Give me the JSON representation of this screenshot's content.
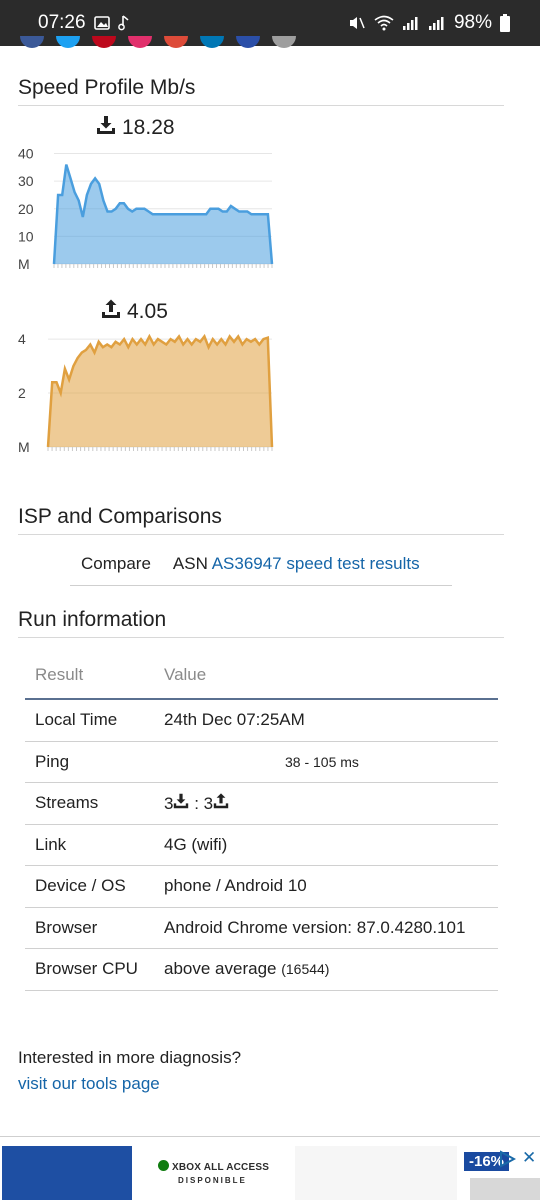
{
  "status_bar": {
    "time": "07:26",
    "battery": "98%"
  },
  "social_colors": [
    "#3b5998",
    "#1da1f2",
    "#bd081c",
    "#e1306c",
    "#dd4b39",
    "#0077b5",
    "#2b4fa8",
    "#9e9e9e"
  ],
  "speed_profile": {
    "heading": "Speed Profile Mb/s",
    "download": {
      "value": "18.28",
      "y_ticks": [
        "40",
        "30",
        "20",
        "10",
        "M"
      ],
      "color": "#4a9ede"
    },
    "upload": {
      "value": "4.05",
      "y_ticks": [
        "4",
        "2",
        "M"
      ],
      "color": "#e0a040"
    }
  },
  "chart_data": [
    {
      "type": "area",
      "y_ticks": [
        "40",
        "30",
        "20",
        "10",
        "M"
      ],
      "ylim": [
        0,
        42
      ],
      "grid": true,
      "values": [
        0,
        25,
        25,
        36,
        31,
        26,
        23,
        17,
        25,
        29,
        31,
        29,
        23,
        19,
        19,
        20,
        22,
        22,
        20,
        19,
        20,
        20,
        20,
        19,
        18,
        18,
        18,
        18,
        18,
        18,
        18,
        18,
        18,
        18,
        18,
        18,
        18,
        18,
        20,
        20,
        20,
        19,
        19,
        21,
        20,
        19,
        19,
        19,
        18,
        18,
        18,
        18,
        18,
        0
      ]
    },
    {
      "type": "area",
      "y_ticks": [
        "4",
        "2",
        "M"
      ],
      "ylim": [
        0,
        4.3
      ],
      "grid": true,
      "values": [
        0,
        2.4,
        2.4,
        2.0,
        2.9,
        2.5,
        3.0,
        3.3,
        3.5,
        3.6,
        3.8,
        3.5,
        3.9,
        3.7,
        3.8,
        3.7,
        3.9,
        3.8,
        4.0,
        3.7,
        4.0,
        3.8,
        4.0,
        3.8,
        4.1,
        3.8,
        4.0,
        3.9,
        3.8,
        4.0,
        3.9,
        4.1,
        3.8,
        4.0,
        3.8,
        4.0,
        3.9,
        4.1,
        3.7,
        4.0,
        3.8,
        4.0,
        3.8,
        4.1,
        3.9,
        4.1,
        3.8,
        4.0,
        3.9,
        4.0,
        3.8,
        4.0,
        4.05,
        0
      ]
    }
  ],
  "isp": {
    "heading": "ISP and Comparisons",
    "compare_label": "Compare",
    "asn_prefix": "ASN",
    "asn_link": "AS36947 speed test results"
  },
  "run_info": {
    "heading": "Run information",
    "col_result": "Result",
    "col_value": "Value",
    "local_time_label": "Local Time",
    "local_time_value": "24th Dec 07:25AM",
    "ping_label": "Ping",
    "ping_value": "38 - 105 ms",
    "streams_label": "Streams",
    "streams_down": "3",
    "streams_sep": " : ",
    "streams_up": "3",
    "link_label": "Link",
    "link_value": "4G (wifi)",
    "device_label": "Device / OS",
    "device_value": "phone / Android 10",
    "browser_label": "Browser",
    "browser_value": "Android Chrome version: 87.0.4280.101",
    "cpu_label": "Browser CPU",
    "cpu_value": "above average",
    "cpu_score": "(16544)"
  },
  "more": {
    "text": "Interested in more diagnosis?",
    "link": "visit our tools page"
  },
  "ad": {
    "xbox_text": "XBOX ALL ACCESS",
    "xbox_sub": "DISPONIBLE",
    "discount": "-16%",
    "close": "✕"
  }
}
